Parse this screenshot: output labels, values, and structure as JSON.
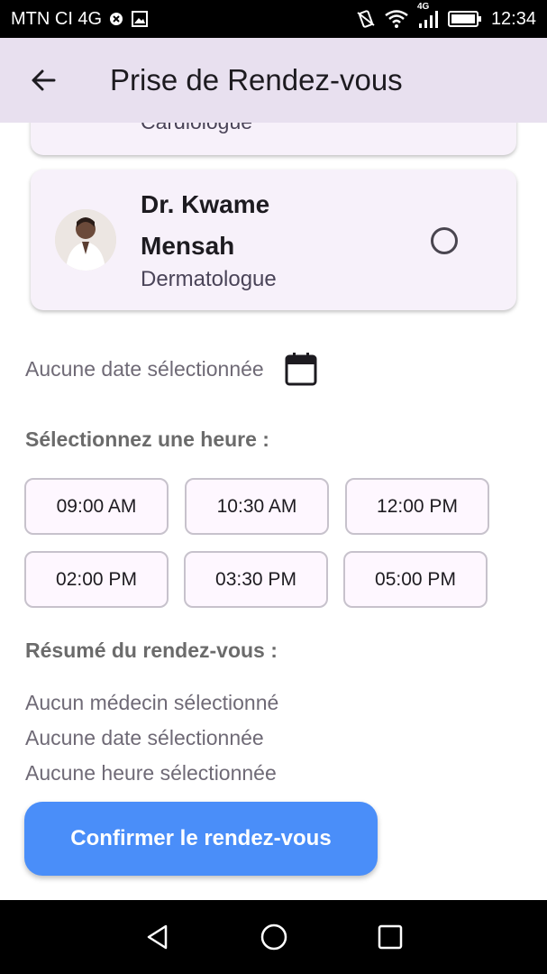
{
  "status_bar": {
    "carrier": "MTN CI 4G",
    "network": "4G",
    "time": "12:34"
  },
  "app_bar": {
    "title": "Prise de Rendez-vous"
  },
  "doctors": [
    {
      "specialty": "Cardiologue"
    },
    {
      "name": "Dr. Kwame Mensah",
      "specialty": "Dermatologue",
      "selected": false
    }
  ],
  "date": {
    "label": "Aucune date sélectionnée"
  },
  "time_section": {
    "title": "Sélectionnez une heure :",
    "slots": [
      "09:00 AM",
      "10:30 AM",
      "12:00 PM",
      "02:00 PM",
      "03:30 PM",
      "05:00 PM"
    ]
  },
  "summary": {
    "title": "Résumé du rendez-vous :",
    "doctor": "Aucun médecin sélectionné",
    "date": "Aucune date sélectionnée",
    "time": "Aucune heure sélectionnée"
  },
  "confirm_button": "Confirmer le rendez-vous",
  "colors": {
    "app_bar": "#e8e0ef",
    "card": "#f7f1fa",
    "primary_button": "#4a8ef9",
    "chip_border": "#c7c2cc"
  }
}
